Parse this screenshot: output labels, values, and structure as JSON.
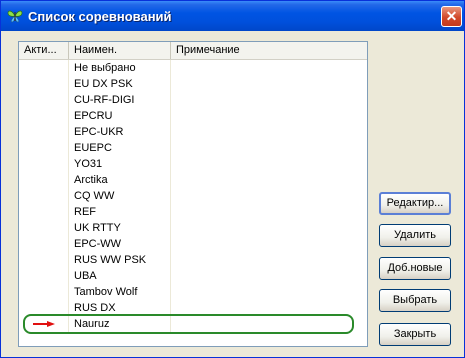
{
  "window": {
    "title": "Список соревнований",
    "close_glyph": "✕"
  },
  "list": {
    "columns": [
      "Акти...",
      "Наимен.",
      "Примечание"
    ],
    "rows": [
      {
        "name": "Не выбрано",
        "note": ""
      },
      {
        "name": "EU DX PSK",
        "note": ""
      },
      {
        "name": "CU-RF-DIGI",
        "note": ""
      },
      {
        "name": "EPCRU",
        "note": ""
      },
      {
        "name": "EPC-UKR",
        "note": ""
      },
      {
        "name": "EUEPC",
        "note": ""
      },
      {
        "name": "YO31",
        "note": ""
      },
      {
        "name": "Arctika",
        "note": ""
      },
      {
        "name": "CQ WW",
        "note": ""
      },
      {
        "name": "REF",
        "note": ""
      },
      {
        "name": "UK RTTY",
        "note": ""
      },
      {
        "name": "EPC-WW",
        "note": ""
      },
      {
        "name": "RUS WW PSK",
        "note": ""
      },
      {
        "name": "UBA",
        "note": ""
      },
      {
        "name": "Tambov Wolf",
        "note": ""
      },
      {
        "name": "RUS DX",
        "note": ""
      },
      {
        "name": "Nauruz",
        "note": ""
      }
    ],
    "highlight_color": "#2a8a2a",
    "arrow_color": "#e01010"
  },
  "buttons": {
    "edit": "Редактир...",
    "delete": "Удалить",
    "add_new": "Доб.новые",
    "select": "Выбрать",
    "close": "Закрыть"
  },
  "icons": {
    "app": "butterfly-icon",
    "close": "close-icon",
    "arrow": "red-arrow-icon"
  }
}
